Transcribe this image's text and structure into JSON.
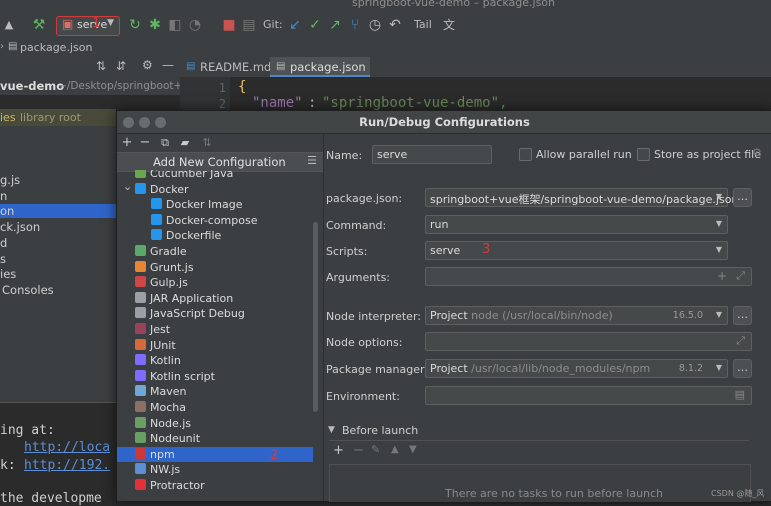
{
  "window": {
    "title": "springboot-vue-demo – package.json"
  },
  "toolbar": {
    "run_config": "serve",
    "git_label": "Git:",
    "tail_label": "Tail",
    "annotation_1": "1"
  },
  "navbar": {
    "file_label": "package.json"
  },
  "project": {
    "path_label": "vue-demo",
    "path_hint": "~/Desktop/springboot+vue",
    "ext_libs_prefix": "ies",
    "ext_libs_label": "library root",
    "tree_items": [
      "g.js",
      "n",
      "on",
      "ck.json",
      "d",
      "s",
      "ies",
      "Consoles"
    ]
  },
  "terminal": {
    "line1": "ing at:",
    "line2_prefix": "",
    "line2_link": "http://loca",
    "line3_prefix": "k:",
    "line3_link": "http://192.",
    "line4": "the developme"
  },
  "editor": {
    "tabs": [
      {
        "label": "README.md"
      },
      {
        "label": "package.json"
      }
    ],
    "lines": [
      {
        "num": "1",
        "text": "{"
      },
      {
        "num": "2",
        "key": "\"name\"",
        "value": "\"springboot-vue-demo\","
      }
    ]
  },
  "dialog": {
    "title": "Run/Debug Configurations",
    "add_new": "Add New Configuration",
    "annotation_2": "2",
    "annotation_3": "3",
    "items": [
      {
        "label": "Cucumber Java",
        "color": "#6aa84f"
      },
      {
        "label": "Docker",
        "color": "#2496ed"
      },
      {
        "label": "Docker Image",
        "color": "#2496ed"
      },
      {
        "label": "Docker-compose",
        "color": "#2496ed"
      },
      {
        "label": "Dockerfile",
        "color": "#2496ed"
      },
      {
        "label": "Gradle",
        "color": "#5aa96b"
      },
      {
        "label": "Grunt.js",
        "color": "#e48632"
      },
      {
        "label": "Gulp.js",
        "color": "#cf4647"
      },
      {
        "label": "JAR Application",
        "color": "#9aa0a6"
      },
      {
        "label": "JavaScript Debug",
        "color": "#9aa0a6"
      },
      {
        "label": "Jest",
        "color": "#99425b"
      },
      {
        "label": "JUnit",
        "color": "#d66b3a"
      },
      {
        "label": "Kotlin",
        "color": "#7f6cff"
      },
      {
        "label": "Kotlin script",
        "color": "#7f6cff"
      },
      {
        "label": "Maven",
        "color": "#6ea7d8"
      },
      {
        "label": "Mocha",
        "color": "#8d6e63"
      },
      {
        "label": "Node.js",
        "color": "#68a063"
      },
      {
        "label": "Nodeunit",
        "color": "#68a063"
      },
      {
        "label": "npm",
        "color": "#cb3837"
      },
      {
        "label": "NW.js",
        "color": "#5a8fd6"
      },
      {
        "label": "Protractor",
        "color": "#e23237"
      }
    ],
    "form": {
      "name_label": "Name:",
      "name_value": "serve",
      "allow_parallel": "Allow parallel run",
      "store_project": "Store as project file",
      "package_json_label": "package.json:",
      "package_json_value": "springboot+vue框架/springboot-vue-demo/package.json",
      "command_label": "Command:",
      "command_value": "run",
      "scripts_label": "Scripts:",
      "scripts_value": "serve",
      "arguments_label": "Arguments:",
      "node_interpreter_label": "Node interpreter:",
      "node_interpreter_kind": "Project",
      "node_interpreter_path": "node (/usr/local/bin/node)",
      "node_interpreter_version": "16.5.0",
      "node_options_label": "Node options:",
      "package_manager_label": "Package manager:",
      "package_manager_kind": "Project",
      "package_manager_path": "/usr/local/lib/node_modules/npm",
      "package_manager_version": "8.1.2",
      "environment_label": "Environment:",
      "before_launch": "Before launch",
      "no_tasks": "There are no tasks to run before launch"
    }
  },
  "watermark": "CSDN @随_风"
}
